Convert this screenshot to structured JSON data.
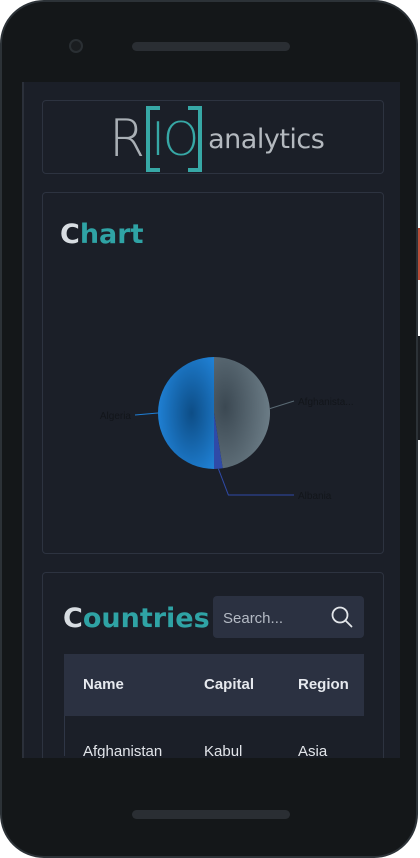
{
  "logo": {
    "left_text": "R",
    "box_text": "IO",
    "right_text": "analytics"
  },
  "chart_section": {
    "title_first": "C",
    "title_rest": "hart"
  },
  "chart_data": {
    "type": "pie",
    "labels": [
      "Afghanista...",
      "Albania",
      "Algeria"
    ],
    "values": [
      47.5,
      2.5,
      50
    ],
    "colors": [
      "#5a6a74",
      "#2f4aa8",
      "#1f7fd6"
    ]
  },
  "countries_section": {
    "title_first": "C",
    "title_rest": "ountries",
    "search_placeholder": "Search...",
    "columns": [
      "Name",
      "Capital",
      "Region"
    ],
    "rows": [
      [
        "Afghanistan",
        "Kabul",
        "Asia"
      ]
    ]
  },
  "icons": {
    "search": "search-icon",
    "camera": "camera-icon"
  }
}
